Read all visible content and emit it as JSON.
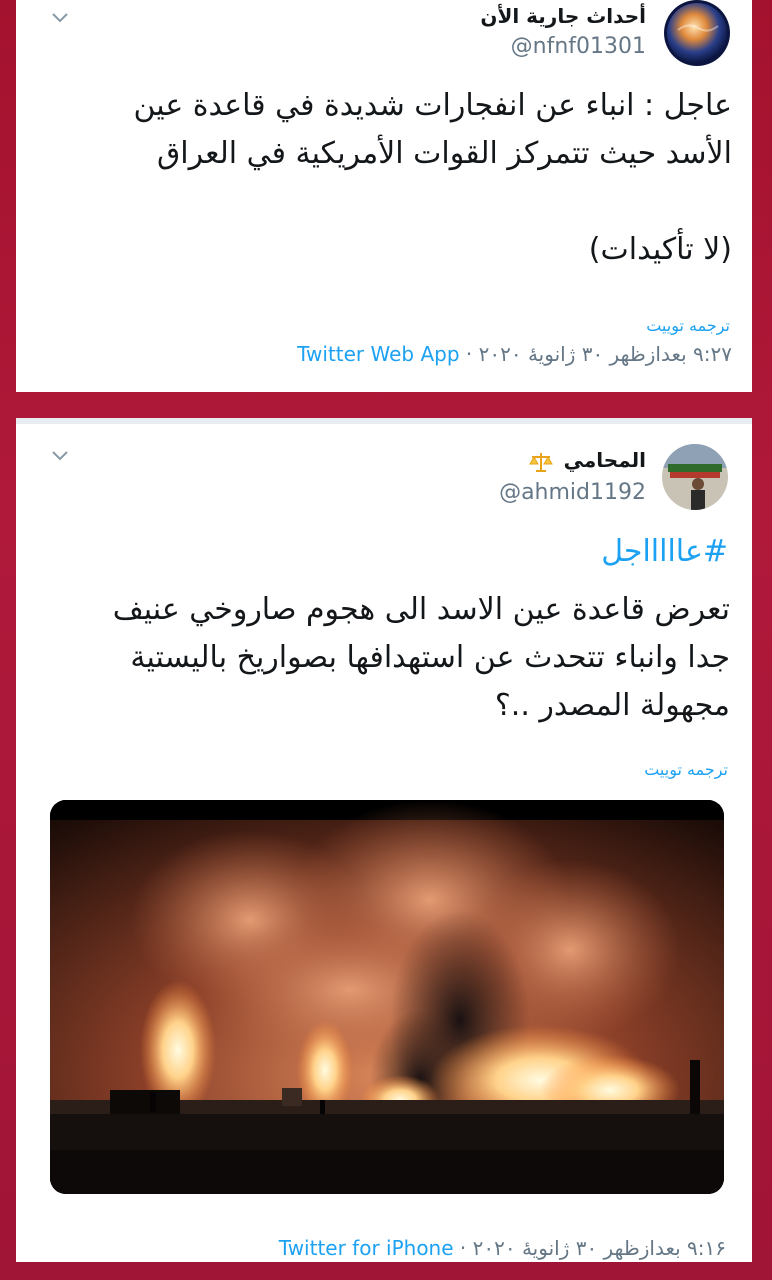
{
  "tweets": [
    {
      "name": "أحداث جارية الأن",
      "handle": "@nfnf01301",
      "body_lines": [
        "عاجل : انباء عن انفجارات شديدة في قاعدة عين",
        "الأسد حيث تتمركز القوات الأمريكية في العراق",
        "",
        "(لا تأكيدات)"
      ],
      "translate_label": "ترجمه توييت",
      "time": "٩:٢٧ بعدازظهر ٣٠ ژانویهٔ ٢٠٢٠ ·",
      "source": "Twitter Web App"
    },
    {
      "name": "المحامي",
      "name_emoji": "⚖️",
      "handle": "@ahmid1192",
      "hashtag": "#عاااااجل",
      "body_lines": [
        "تعرض قاعدة عين الاسد الى هجوم صاروخي عنيف",
        "جدا وانباء تتحدث عن استهدافها بصواريخ باليستية",
        "مجهولة المصدر ..؟"
      ],
      "translate_label": "ترجمه توييت",
      "time": "٩:١۶ بعدازظهر ٣٠ ژانویهٔ ٢٠٢٠ ·",
      "source": "Twitter for iPhone"
    }
  ],
  "icons": {
    "chevron": "chevron-down-icon",
    "scale": "scale-icon"
  },
  "colors": {
    "background": "#a3122e",
    "link": "#1da1f2",
    "text": "#14171a",
    "muted": "#657786"
  }
}
